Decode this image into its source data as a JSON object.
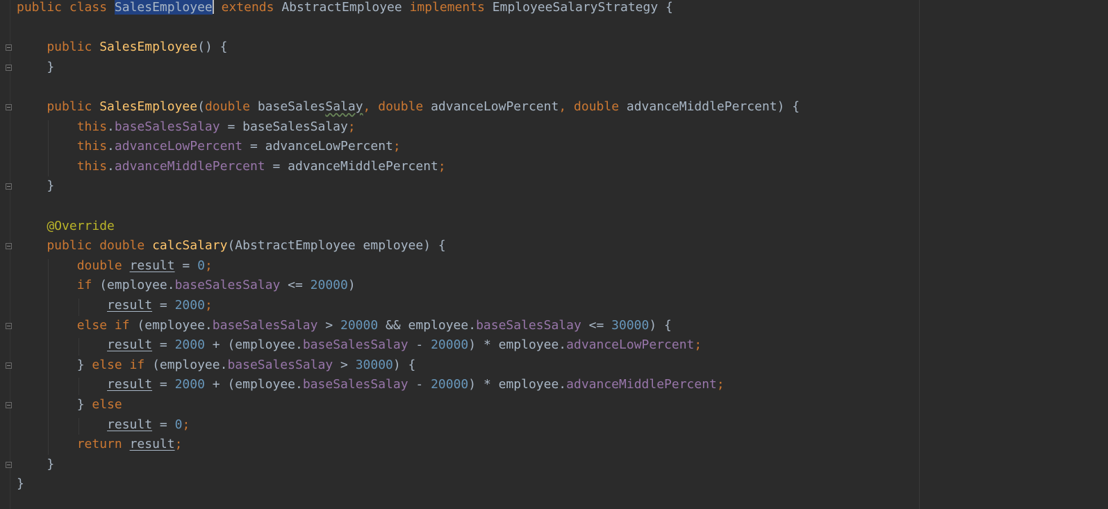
{
  "editor": {
    "language": "java",
    "colors": {
      "background": "#2b2b2b",
      "keyword": "#cc7832",
      "function": "#ffc66d",
      "field": "#9876aa",
      "number": "#6897bb",
      "annotation": "#bbb529",
      "plain": "#a9b7c6",
      "selection": "#214283"
    },
    "lines": [
      [
        {
          "t": "public class ",
          "c": "k"
        },
        {
          "t": "SalesEmployee",
          "c": "p sel",
          "caret": true
        },
        {
          "t": " extends ",
          "c": "k"
        },
        {
          "t": "AbstractEmployee ",
          "c": "p"
        },
        {
          "t": "implements ",
          "c": "k"
        },
        {
          "t": "EmployeeSalaryStrategy {",
          "c": "p"
        }
      ],
      [],
      [
        {
          "t": "    public ",
          "c": "k"
        },
        {
          "t": "SalesEmployee",
          "c": "fn"
        },
        {
          "t": "() {",
          "c": "p"
        }
      ],
      [
        {
          "t": "    }",
          "c": "p"
        }
      ],
      [],
      [
        {
          "t": "    public ",
          "c": "k"
        },
        {
          "t": "SalesEmployee",
          "c": "fn"
        },
        {
          "t": "(",
          "c": "p"
        },
        {
          "t": "double ",
          "c": "k"
        },
        {
          "t": "baseSales",
          "c": "p"
        },
        {
          "t": "Salay",
          "c": "p wavy"
        },
        {
          "t": ", ",
          "c": "k"
        },
        {
          "t": "double ",
          "c": "k"
        },
        {
          "t": "advanceLowPercent",
          "c": "p"
        },
        {
          "t": ", ",
          "c": "k"
        },
        {
          "t": "double ",
          "c": "k"
        },
        {
          "t": "advanceMiddlePercent) {",
          "c": "p"
        }
      ],
      [
        {
          "t": "        this",
          "c": "k"
        },
        {
          "t": ".",
          "c": "p"
        },
        {
          "t": "baseSalesSalay",
          "c": "fld"
        },
        {
          "t": " = baseSalesSalay",
          "c": "p"
        },
        {
          "t": ";",
          "c": "k"
        }
      ],
      [
        {
          "t": "        this",
          "c": "k"
        },
        {
          "t": ".",
          "c": "p"
        },
        {
          "t": "advanceLowPercent",
          "c": "fld"
        },
        {
          "t": " = advanceLowPercent",
          "c": "p"
        },
        {
          "t": ";",
          "c": "k"
        }
      ],
      [
        {
          "t": "        this",
          "c": "k"
        },
        {
          "t": ".",
          "c": "p"
        },
        {
          "t": "advanceMiddlePercent",
          "c": "fld"
        },
        {
          "t": " = advanceMiddlePercent",
          "c": "p"
        },
        {
          "t": ";",
          "c": "k"
        }
      ],
      [
        {
          "t": "    }",
          "c": "p"
        }
      ],
      [],
      [
        {
          "t": "    @Override",
          "c": "ann"
        }
      ],
      [
        {
          "t": "    public double ",
          "c": "k"
        },
        {
          "t": "calcSalary",
          "c": "fn"
        },
        {
          "t": "(AbstractEmployee employee) {",
          "c": "p"
        }
      ],
      [
        {
          "t": "        double ",
          "c": "k"
        },
        {
          "t": "result",
          "c": "p uline"
        },
        {
          "t": " = ",
          "c": "p"
        },
        {
          "t": "0",
          "c": "num"
        },
        {
          "t": ";",
          "c": "k"
        }
      ],
      [
        {
          "t": "        if ",
          "c": "k"
        },
        {
          "t": "(employee.",
          "c": "p"
        },
        {
          "t": "baseSalesSalay",
          "c": "fld"
        },
        {
          "t": " <= ",
          "c": "p"
        },
        {
          "t": "20000",
          "c": "num"
        },
        {
          "t": ")",
          "c": "p"
        }
      ],
      [
        {
          "t": "            ",
          "c": "p"
        },
        {
          "t": "result",
          "c": "p uline"
        },
        {
          "t": " = ",
          "c": "p"
        },
        {
          "t": "2000",
          "c": "num"
        },
        {
          "t": ";",
          "c": "k"
        }
      ],
      [
        {
          "t": "        else if ",
          "c": "k"
        },
        {
          "t": "(employee.",
          "c": "p"
        },
        {
          "t": "baseSalesSalay",
          "c": "fld"
        },
        {
          "t": " > ",
          "c": "p"
        },
        {
          "t": "20000",
          "c": "num"
        },
        {
          "t": " && employee.",
          "c": "p"
        },
        {
          "t": "baseSalesSalay",
          "c": "fld"
        },
        {
          "t": " <= ",
          "c": "p"
        },
        {
          "t": "30000",
          "c": "num"
        },
        {
          "t": ") {",
          "c": "p"
        }
      ],
      [
        {
          "t": "            ",
          "c": "p"
        },
        {
          "t": "result",
          "c": "p uline"
        },
        {
          "t": " = ",
          "c": "p"
        },
        {
          "t": "2000",
          "c": "num"
        },
        {
          "t": " + (employee.",
          "c": "p"
        },
        {
          "t": "baseSalesSalay",
          "c": "fld"
        },
        {
          "t": " - ",
          "c": "p"
        },
        {
          "t": "20000",
          "c": "num"
        },
        {
          "t": ") * employee.",
          "c": "p"
        },
        {
          "t": "advanceLowPercent",
          "c": "fld"
        },
        {
          "t": ";",
          "c": "k"
        }
      ],
      [
        {
          "t": "        } ",
          "c": "p"
        },
        {
          "t": "else if ",
          "c": "k"
        },
        {
          "t": "(employee.",
          "c": "p"
        },
        {
          "t": "baseSalesSalay",
          "c": "fld"
        },
        {
          "t": " > ",
          "c": "p"
        },
        {
          "t": "30000",
          "c": "num"
        },
        {
          "t": ") {",
          "c": "p"
        }
      ],
      [
        {
          "t": "            ",
          "c": "p"
        },
        {
          "t": "result",
          "c": "p uline"
        },
        {
          "t": " = ",
          "c": "p"
        },
        {
          "t": "2000",
          "c": "num"
        },
        {
          "t": " + (employee.",
          "c": "p"
        },
        {
          "t": "baseSalesSalay",
          "c": "fld"
        },
        {
          "t": " - ",
          "c": "p"
        },
        {
          "t": "20000",
          "c": "num"
        },
        {
          "t": ") * employee.",
          "c": "p"
        },
        {
          "t": "advanceMiddlePercent",
          "c": "fld"
        },
        {
          "t": ";",
          "c": "k"
        }
      ],
      [
        {
          "t": "        } ",
          "c": "p"
        },
        {
          "t": "else",
          "c": "k"
        }
      ],
      [
        {
          "t": "            ",
          "c": "p"
        },
        {
          "t": "result",
          "c": "p uline"
        },
        {
          "t": " = ",
          "c": "p"
        },
        {
          "t": "0",
          "c": "num"
        },
        {
          "t": ";",
          "c": "k"
        }
      ],
      [
        {
          "t": "        return ",
          "c": "k"
        },
        {
          "t": "result",
          "c": "p uline"
        },
        {
          "t": ";",
          "c": "k"
        }
      ],
      [
        {
          "t": "    }",
          "c": "p"
        }
      ],
      [
        {
          "t": "}",
          "c": "p"
        }
      ]
    ]
  }
}
